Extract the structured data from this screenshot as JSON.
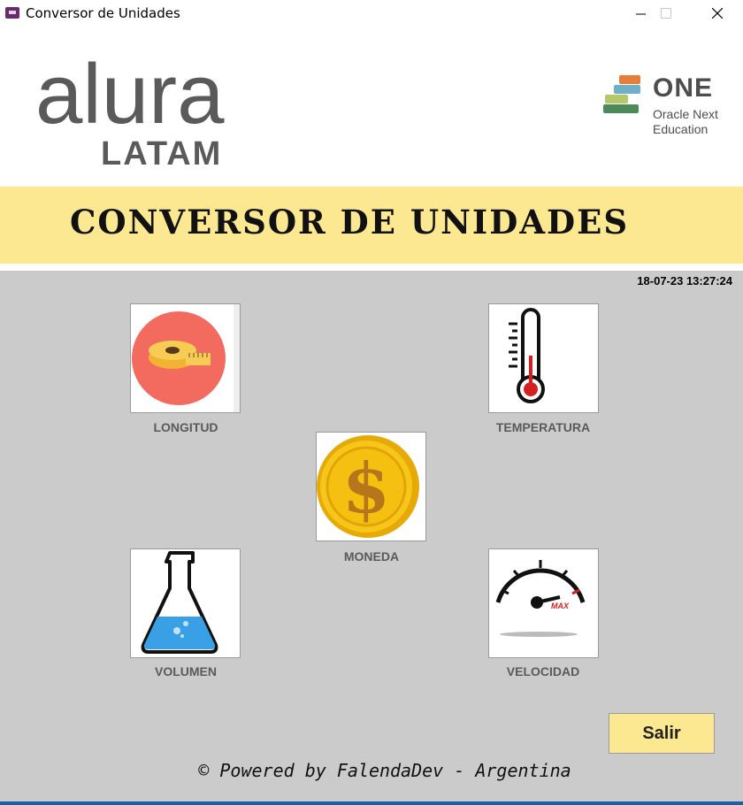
{
  "window": {
    "title": "Conversor de Unidades"
  },
  "header": {
    "alura_text": "alura",
    "latam_text": "LATAM",
    "one_title": "ONE",
    "one_line1": "Oracle Next",
    "one_line2": "Education"
  },
  "banner": {
    "title": "CONVERSOR DE UNIDADES"
  },
  "clock": "18-07-23 13:27:24",
  "tiles": [
    {
      "label": "LONGITUD",
      "icon": "measuring-tape-icon"
    },
    {
      "label": "TEMPERATURA",
      "icon": "thermometer-icon"
    },
    {
      "label": "MONEDA",
      "icon": "dollar-coin-icon"
    },
    {
      "label": "VOLUMEN",
      "icon": "flask-icon"
    },
    {
      "label": "VELOCIDAD",
      "icon": "speedometer-icon"
    }
  ],
  "exit_button": "Salir",
  "footer": "© Powered by FalendaDev - Argentina",
  "colors": {
    "banner_bg": "#fde892",
    "main_bg": "#cbcbcb",
    "label_text": "#5a5a5a"
  }
}
